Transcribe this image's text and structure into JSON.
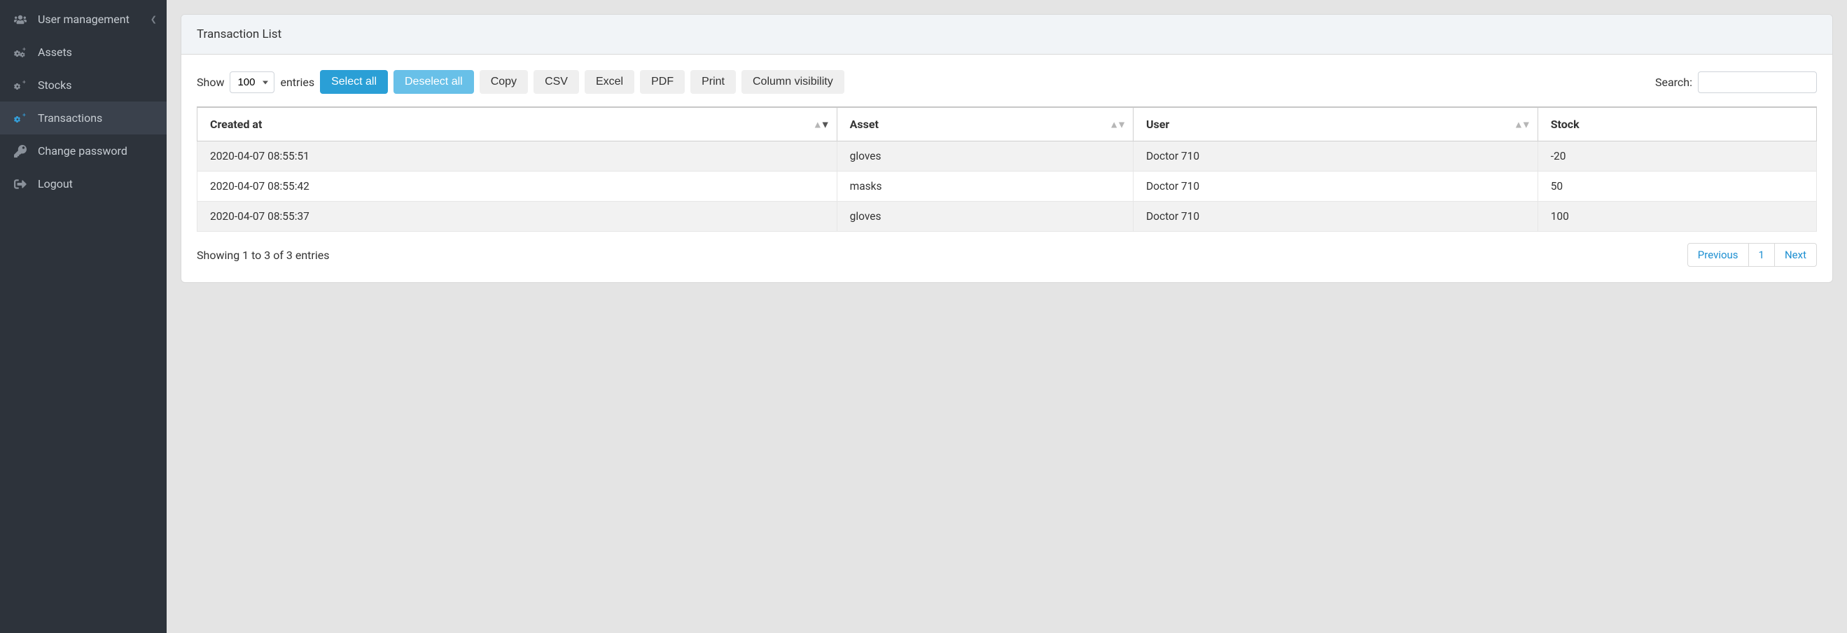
{
  "sidebar": {
    "items": [
      {
        "label": "User management",
        "has_submenu": true
      },
      {
        "label": "Assets"
      },
      {
        "label": "Stocks"
      },
      {
        "label": "Transactions",
        "active": true
      },
      {
        "label": "Change password"
      },
      {
        "label": "Logout"
      }
    ]
  },
  "card": {
    "title": "Transaction List"
  },
  "toolbar": {
    "show_label": "Show",
    "entries_label": "entries",
    "length_value": "100",
    "select_all": "Select all",
    "deselect_all": "Deselect all",
    "copy": "Copy",
    "csv": "CSV",
    "excel": "Excel",
    "pdf": "PDF",
    "print": "Print",
    "colvis": "Column visibility",
    "search_label": "Search:",
    "search_value": ""
  },
  "table": {
    "columns": [
      "Created at",
      "Asset",
      "User",
      "Stock"
    ],
    "rows": [
      {
        "created_at": "2020-04-07 08:55:51",
        "asset": "gloves",
        "user": "Doctor 710",
        "stock": "-20"
      },
      {
        "created_at": "2020-04-07 08:55:42",
        "asset": "masks",
        "user": "Doctor 710",
        "stock": "50"
      },
      {
        "created_at": "2020-04-07 08:55:37",
        "asset": "gloves",
        "user": "Doctor 710",
        "stock": "100"
      }
    ]
  },
  "footer": {
    "info": "Showing 1 to 3 of 3 entries",
    "prev": "Previous",
    "page": "1",
    "next": "Next"
  }
}
